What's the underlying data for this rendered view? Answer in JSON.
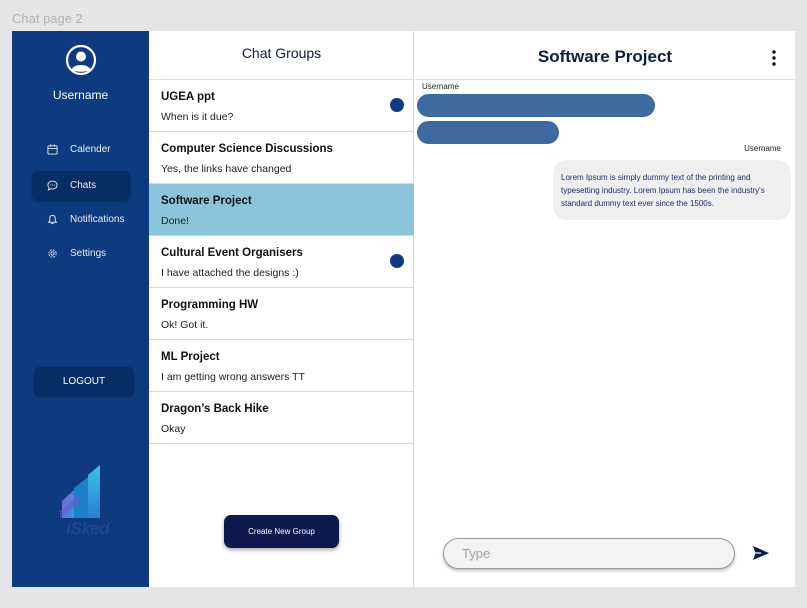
{
  "frame_label": "Chat page 2",
  "sidebar": {
    "username": "Username",
    "items": [
      {
        "label": "Calender",
        "icon": "calendar-icon"
      },
      {
        "label": "Chats",
        "icon": "chat-bubble-icon"
      },
      {
        "label": "Notifications",
        "icon": "bell-icon"
      },
      {
        "label": "Settings",
        "icon": "gear-icon"
      }
    ],
    "logout_label": "LOGOUT",
    "logo_text": "iSked"
  },
  "chat_list": {
    "title": "Chat Groups",
    "groups": [
      {
        "name": "UGEA  ppt",
        "last_message": "When is it due?",
        "unread": true
      },
      {
        "name": "Computer Science Discussions",
        "last_message": "Yes, the links have changed",
        "unread": false
      },
      {
        "name": "Software Project",
        "last_message": "Done!",
        "unread": false,
        "selected": true
      },
      {
        "name": "Cultural Event Organisers",
        "last_message": "I have attached the designs :)",
        "unread": true
      },
      {
        "name": "Programming HW",
        "last_message": "Ok! Got it.",
        "unread": false
      },
      {
        "name": "ML Project",
        "last_message": "I am getting wrong answers TT",
        "unread": false
      },
      {
        "name": "Dragon’s Back Hike",
        "last_message": "Okay",
        "unread": false
      }
    ],
    "create_button_label": "Create New Group"
  },
  "chat": {
    "title": "Software Project",
    "incoming_sender": "Username",
    "outgoing_sender": "Username",
    "outgoing_message": "Lorem Ipsum is simply dummy text of the printing and typesetting industry. Lorem Ipsum has been the industry's standard dummy text ever since the 1500s.",
    "input_placeholder": "Type"
  },
  "colors": {
    "sidebar_bg": "#0e3b80",
    "accent_dark": "#0e1a4d",
    "selected_row": "#8cc4dc",
    "bubble_incoming": "#3e6a9f",
    "bubble_outgoing": "#efefef"
  }
}
